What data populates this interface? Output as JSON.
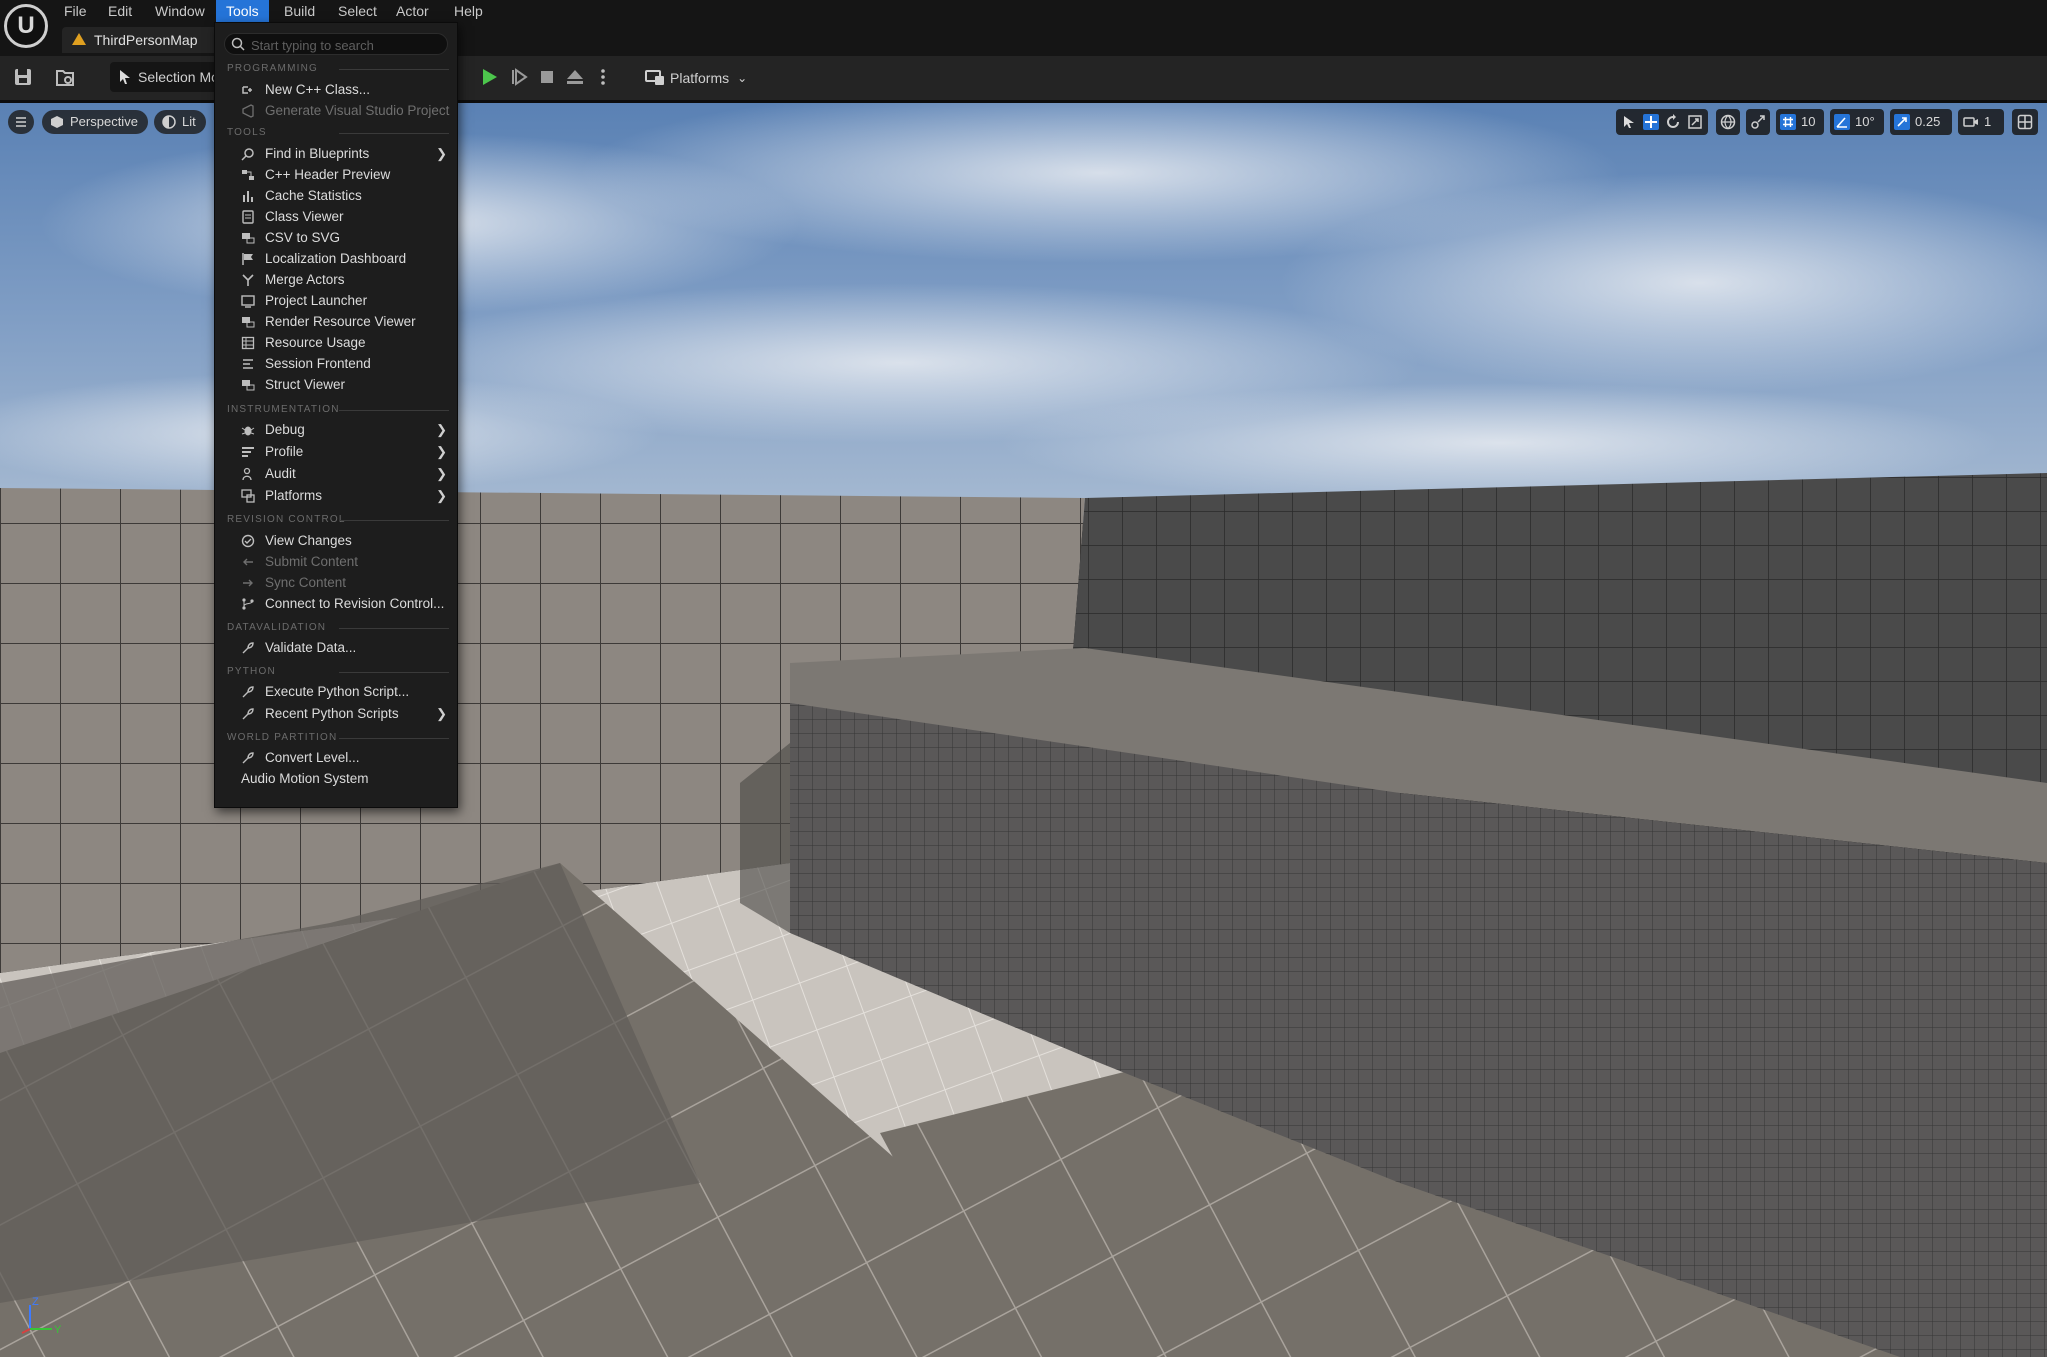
{
  "menubar": {
    "logo_glyph": "U",
    "items": [
      "File",
      "Edit",
      "Window",
      "Tools",
      "Build",
      "Select",
      "Actor",
      "Help"
    ],
    "active": "Tools"
  },
  "level_tab": {
    "label": "ThirdPersonMap"
  },
  "toolbar": {
    "selection_mode_label": "Selection Mode",
    "platforms_label": "Platforms"
  },
  "viewport": {
    "view_mode_perspective": "Perspective",
    "view_mode_lit": "Lit",
    "grid_snap_value": "10",
    "rotation_snap_value": "10°",
    "scale_snap_value": "0.25",
    "camera_speed_value": "1"
  },
  "tools_menu": {
    "search_placeholder": "Start typing to search",
    "sections": {
      "programming": "PROGRAMMING",
      "tools": "TOOLS",
      "instrumentation": "INSTRUMENTATION",
      "revision_control": "REVISION CONTROL",
      "datavalidation": "DATAVALIDATION",
      "python": "PYTHON",
      "world_partition": "WORLD PARTITION"
    },
    "items": {
      "new_cpp_class": "New C++ Class...",
      "generate_vs_project": "Generate Visual Studio Project",
      "find_in_blueprints": "Find in Blueprints",
      "cpp_header_preview": "C++ Header Preview",
      "cache_statistics": "Cache Statistics",
      "class_viewer": "Class Viewer",
      "csv_to_svg": "CSV to SVG",
      "localization_dashboard": "Localization Dashboard",
      "merge_actors": "Merge Actors",
      "project_launcher": "Project Launcher",
      "render_resource_viewer": "Render Resource Viewer",
      "resource_usage": "Resource Usage",
      "session_frontend": "Session Frontend",
      "struct_viewer": "Struct Viewer",
      "debug": "Debug",
      "profile": "Profile",
      "audit": "Audit",
      "platforms": "Platforms",
      "view_changes": "View Changes",
      "submit_content": "Submit Content",
      "sync_content": "Sync Content",
      "connect_revision_control": "Connect to Revision Control...",
      "validate_data": "Validate Data...",
      "execute_python_script": "Execute Python Script...",
      "recent_python_scripts": "Recent Python Scripts",
      "convert_level": "Convert Level...",
      "audio_motion_system": "Audio Motion System"
    }
  },
  "axis_gizmo": {
    "z": "Z",
    "y": "Y"
  },
  "colors": {
    "accent": "#2574d8",
    "play_green": "#4cc64c",
    "menu_bg": "#1d1d1d",
    "sky_top": "#4d78b0",
    "wall": "#4f4f4f",
    "floor": "#6f6a66"
  }
}
